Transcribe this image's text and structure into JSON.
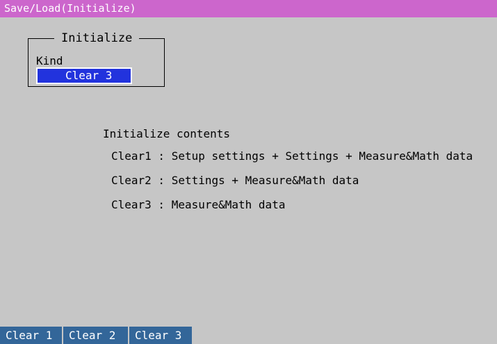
{
  "title_bar": {
    "title": "Save/Load(Initialize)"
  },
  "initialize_group": {
    "title": "Initialize",
    "kind_label": "Kind",
    "kind_value": "Clear 3"
  },
  "contents": {
    "heading": "Initialize contents",
    "lines": [
      "Clear1 : Setup settings + Settings + Measure&Math data",
      "Clear2 : Settings + Measure&Math data",
      "Clear3 : Measure&Math data"
    ]
  },
  "softkeys": [
    {
      "label": "Clear 1"
    },
    {
      "label": "Clear 2"
    },
    {
      "label": "Clear 3"
    }
  ],
  "colors": {
    "background": "#c6c6c6",
    "title_bar": "#cc66cc",
    "selected_field": "#2233dd",
    "softkey": "#336699"
  }
}
